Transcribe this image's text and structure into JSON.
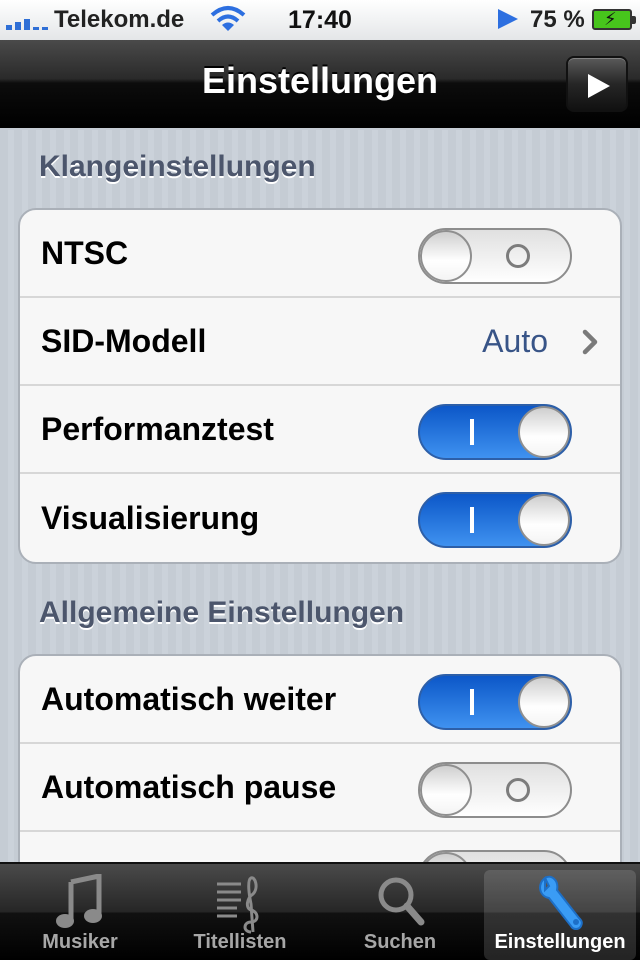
{
  "status_bar": {
    "carrier": "Telekom.de",
    "time": "17:40",
    "battery": "75 %"
  },
  "nav": {
    "title": "Einstellungen"
  },
  "sections": [
    {
      "header": "Klangeinstellungen",
      "rows": [
        {
          "label": "NTSC",
          "type": "switch",
          "on": false
        },
        {
          "label": "SID-Modell",
          "type": "detail",
          "value": "Auto"
        },
        {
          "label": "Performanztest",
          "type": "switch",
          "on": true
        },
        {
          "label": "Visualisierung",
          "type": "switch",
          "on": true
        }
      ]
    },
    {
      "header": "Allgemeine Einstellungen",
      "rows": [
        {
          "label": "Automatisch weiter",
          "type": "switch",
          "on": true
        },
        {
          "label": "Automatisch pause",
          "type": "switch",
          "on": false
        }
      ]
    }
  ],
  "tabs": [
    {
      "label": "Musiker",
      "icon": "music-note-icon"
    },
    {
      "label": "Titellisten",
      "icon": "playlist-icon"
    },
    {
      "label": "Suchen",
      "icon": "search-icon"
    },
    {
      "label": "Einstellungen",
      "icon": "wrench-icon"
    }
  ],
  "colors": {
    "accent": "#385487",
    "switch_on": "#1c6fe0",
    "section_header": "#4c566c"
  }
}
